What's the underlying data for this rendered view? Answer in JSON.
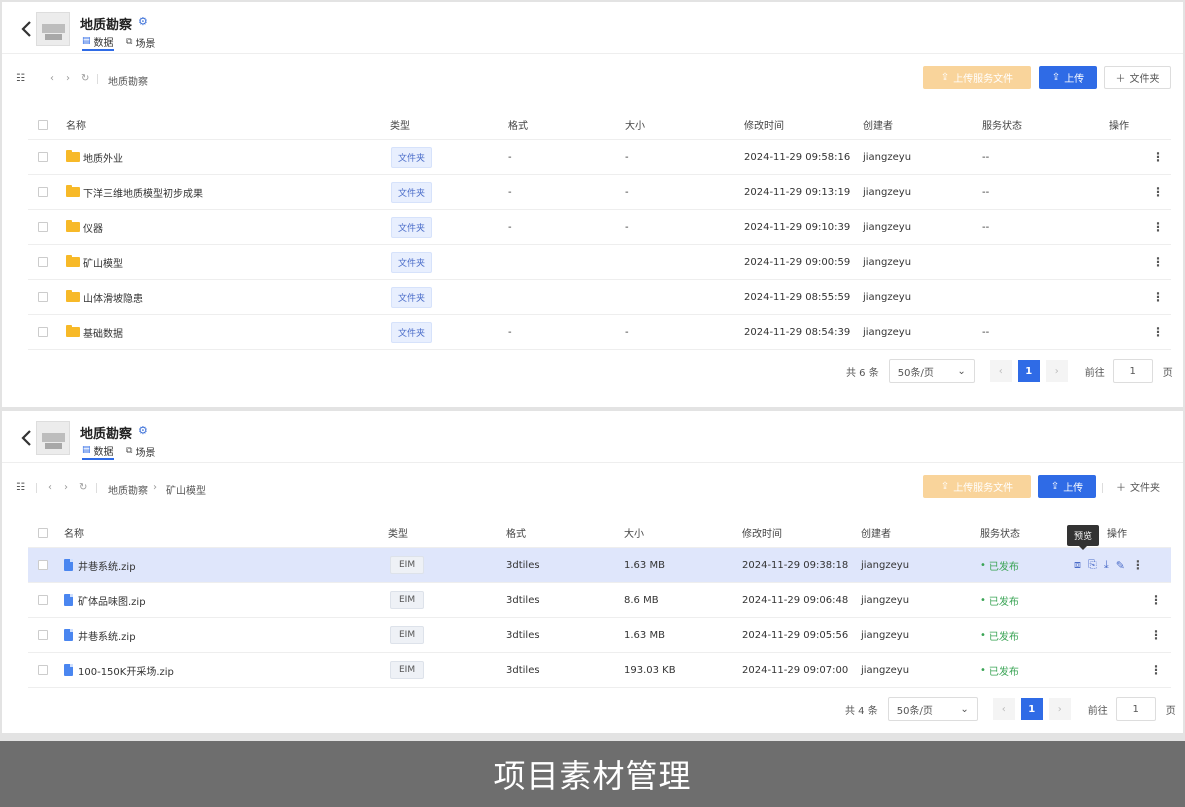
{
  "panel1": {
    "title": "地质勘察",
    "tabs": [
      {
        "label": "数据"
      },
      {
        "label": "场景"
      }
    ],
    "breadcrumb": [
      "地质勘察"
    ],
    "buttons": {
      "upload_service": "上传服务文件",
      "upload": "上传",
      "folder": "文件夹"
    },
    "columns": [
      "名称",
      "类型",
      "格式",
      "大小",
      "修改时间",
      "创建者",
      "服务状态",
      "操作"
    ],
    "rows": [
      {
        "name": "地质外业",
        "type": "文件夹",
        "format": "-",
        "size": "-",
        "modified": "2024-11-29 09:58:16",
        "creator": "jiangzeyu",
        "status": "--"
      },
      {
        "name": "下洋三维地质模型初步成果",
        "type": "文件夹",
        "format": "-",
        "size": "-",
        "modified": "2024-11-29 09:13:19",
        "creator": "jiangzeyu",
        "status": "--"
      },
      {
        "name": "仪器",
        "type": "文件夹",
        "format": "-",
        "size": "-",
        "modified": "2024-11-29 09:10:39",
        "creator": "jiangzeyu",
        "status": "--"
      },
      {
        "name": "矿山模型",
        "type": "文件夹",
        "format": "",
        "size": "",
        "modified": "2024-11-29 09:00:59",
        "creator": "jiangzeyu",
        "status": ""
      },
      {
        "name": "山体滑坡隐患",
        "type": "文件夹",
        "format": "",
        "size": "",
        "modified": "2024-11-29 08:55:59",
        "creator": "jiangzeyu",
        "status": ""
      },
      {
        "name": "基础数据",
        "type": "文件夹",
        "format": "-",
        "size": "-",
        "modified": "2024-11-29 08:54:39",
        "creator": "jiangzeyu",
        "status": "--"
      }
    ],
    "pager": {
      "total": "共 6 条",
      "per_page": "50条/页",
      "current": "1",
      "goto_label": "前往",
      "goto_value": "1",
      "page_suffix": "页"
    }
  },
  "panel2": {
    "title": "地质勘察",
    "tabs": [
      {
        "label": "数据"
      },
      {
        "label": "场景"
      }
    ],
    "breadcrumb": [
      "地质勘察",
      "矿山模型"
    ],
    "buttons": {
      "upload_service": "上传服务文件",
      "upload": "上传",
      "folder": "文件夹"
    },
    "columns": [
      "名称",
      "类型",
      "格式",
      "大小",
      "修改时间",
      "创建者",
      "服务状态",
      "操作"
    ],
    "rows": [
      {
        "name": "井巷系统.zip",
        "type": "EIM",
        "format": "3dtiles",
        "size": "1.63 MB",
        "modified": "2024-11-29 09:38:18",
        "creator": "jiangzeyu",
        "status": "已发布"
      },
      {
        "name": "矿体品味图.zip",
        "type": "EIM",
        "format": "3dtiles",
        "size": "8.6 MB",
        "modified": "2024-11-29 09:06:48",
        "creator": "jiangzeyu",
        "status": "已发布"
      },
      {
        "name": "井巷系统.zip",
        "type": "EIM",
        "format": "3dtiles",
        "size": "1.63 MB",
        "modified": "2024-11-29 09:05:56",
        "creator": "jiangzeyu",
        "status": "已发布"
      },
      {
        "name": "100-150K开采场.zip",
        "type": "EIM",
        "format": "3dtiles",
        "size": "193.03 KB",
        "modified": "2024-11-29 09:07:00",
        "creator": "jiangzeyu",
        "status": "已发布"
      }
    ],
    "tooltip": "预览",
    "pager": {
      "total": "共 4 条",
      "per_page": "50条/页",
      "current": "1",
      "goto_label": "前往",
      "goto_value": "1",
      "page_suffix": "页"
    }
  },
  "banner": {
    "text": "项目素材管理"
  },
  "colors": {
    "primary": "#2f6be6",
    "upload_service": "#f9d49b",
    "folder": "#f7b928",
    "published": "#3aa455",
    "selected_row": "#dfe6fb"
  }
}
